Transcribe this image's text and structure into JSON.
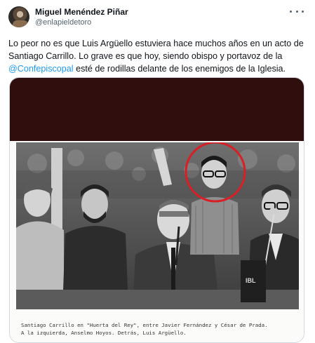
{
  "tweet": {
    "author_name": "Miguel Menéndez Piñar",
    "author_handle": "@enlapieldetoro",
    "text_part1": "Lo peor no es que Luis Argüello estuviera hace muchos años en un acto de Santiago Carrillo. Lo grave es que hoy, siendo obispo y portavoz de la ",
    "mention": "@Confepiscopal",
    "text_part2": " esté de rodillas delante de los enemigos de la Iglesia."
  },
  "media": {
    "caption_line1": "Santiago Carrillo en \"Huerta del Rey\", entre Javier Fernández y César de Prada.",
    "caption_line2": "A la izquierda, Anselmo Hoyos. Detrás, Luis Argüello.",
    "highlight_color": "#d81f26"
  }
}
